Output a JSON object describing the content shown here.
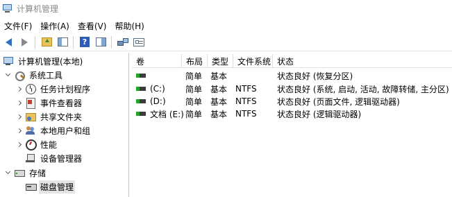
{
  "window": {
    "title": "计算机管理"
  },
  "menu": [
    {
      "label": "文件(F)"
    },
    {
      "label": "操作(A)"
    },
    {
      "label": "查看(V)"
    },
    {
      "label": "帮助(H)"
    }
  ],
  "toolbar": {
    "buttons": [
      {
        "icon": "back-arrow-icon"
      },
      {
        "icon": "forward-arrow-icon"
      },
      {
        "icon": "up-folder-icon"
      },
      {
        "icon": "show-hide-console-tree-icon"
      },
      {
        "icon": "help-icon"
      },
      {
        "icon": "action-pane-icon"
      },
      {
        "icon": "connect-icon"
      },
      {
        "icon": "properties-icon"
      }
    ]
  },
  "tree": {
    "root": {
      "label": "计算机管理(本地)"
    },
    "system_tools": {
      "label": "系统工具"
    },
    "task_scheduler": {
      "label": "任务计划程序"
    },
    "event_viewer": {
      "label": "事件查看器"
    },
    "shared_folders": {
      "label": "共享文件夹"
    },
    "local_users": {
      "label": "本地用户和组"
    },
    "performance": {
      "label": "性能"
    },
    "device_manager": {
      "label": "设备管理器"
    },
    "storage": {
      "label": "存储"
    },
    "disk_management": {
      "label": "磁盘管理"
    }
  },
  "volumes": {
    "columns": [
      "卷",
      "布局",
      "类型",
      "文件系统",
      "状态"
    ],
    "rows": [
      {
        "volume": "",
        "layout": "简单",
        "type": "基本",
        "fs": "",
        "status": "状态良好 (恢复分区)"
      },
      {
        "volume": "(C:)",
        "layout": "简单",
        "type": "基本",
        "fs": "NTFS",
        "status": "状态良好 (系统, 启动, 活动, 故障转储, 主分区)"
      },
      {
        "volume": "(D:)",
        "layout": "简单",
        "type": "基本",
        "fs": "NTFS",
        "status": "状态良好 (页面文件, 逻辑驱动器)"
      },
      {
        "volume": "文档 (E:)",
        "layout": "简单",
        "type": "基本",
        "fs": "NTFS",
        "status": "状态良好 (逻辑驱动器)"
      }
    ]
  }
}
